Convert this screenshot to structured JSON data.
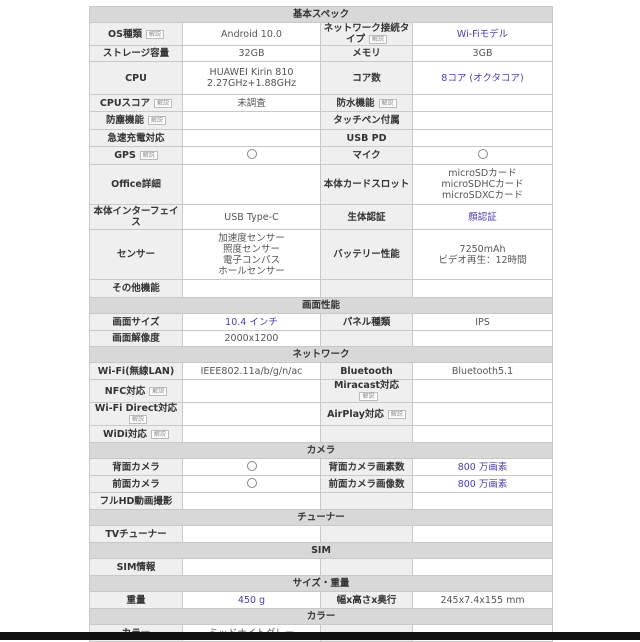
{
  "badge_text": "解説",
  "colors": {
    "link": "#4b3fae",
    "label_bg": "#efefef",
    "section_bg": "#d8d8d8"
  },
  "sections": [
    {
      "title": "基本スペック",
      "rows": [
        {
          "h": 22,
          "l1": "OS種類",
          "b1": true,
          "v1": "Android 10.0",
          "l2": "ネットワーク接続タイプ",
          "b2": true,
          "v2": "Wi-Fiモデル",
          "link2": true
        },
        {
          "h": 16,
          "l1": "ストレージ容量",
          "v1": "32GB",
          "l2": "メモリ",
          "v2": "3GB"
        },
        {
          "h": 33,
          "l1": "CPU",
          "v1": "HUAWEI Kirin 810\n2.27GHz+1.88GHz",
          "l2": "コア数",
          "v2": "8コア (オクタコア)",
          "link2": true
        },
        {
          "h": 17,
          "l1": "CPUスコア",
          "b1": true,
          "v1": "未調査",
          "l2": "防水機能",
          "b2": true,
          "v2": ""
        },
        {
          "h": 18,
          "l1": "防塵機能",
          "b1": true,
          "v1": "",
          "l2": "タッチペン付属",
          "v2": ""
        },
        {
          "h": 17,
          "l1": "急速充電対応",
          "v1": "",
          "l2": "USB PD",
          "v2": ""
        },
        {
          "h": 18,
          "l1": "GPS",
          "b1": true,
          "v1": "○",
          "c1": true,
          "l2": "マイク",
          "v2": "○",
          "c2": true
        },
        {
          "h": 40,
          "l1": "Office詳細",
          "v1": "",
          "l2": "本体カードスロット",
          "v2": "microSDカード\nmicroSDHCカード\nmicroSDXCカード"
        },
        {
          "h": 25,
          "l1": "本体インターフェイス",
          "v1": "USB Type-C",
          "l2": "生体認証",
          "v2": "顔認証",
          "link2": true
        },
        {
          "h": 50,
          "l1": "センサー",
          "v1": "加速度センサー\n照度センサー\n電子コンパス\nホールセンサー",
          "l2": "バッテリー性能",
          "v2": "7250mAh\nビデオ再生：12時間"
        },
        {
          "h": 18,
          "l1": "その他機能",
          "v1": "",
          "l2": "",
          "v2": ""
        }
      ]
    },
    {
      "title": "画面性能",
      "rows": [
        {
          "h": 17,
          "l1": "画面サイズ",
          "v1": "10.4 インチ",
          "link1": true,
          "l2": "パネル種類",
          "v2": "IPS"
        },
        {
          "h": 16,
          "l1": "画面解像度",
          "v1": "2000x1200",
          "l2": "",
          "v2": ""
        }
      ]
    },
    {
      "title": "ネットワーク",
      "rows": [
        {
          "h": 17,
          "l1": "Wi-Fi(無線LAN)",
          "v1": "IEEE802.11a/b/g/n/ac",
          "l2": "Bluetooth",
          "v2": "Bluetooth5.1"
        },
        {
          "h": 17,
          "l1": "NFC対応",
          "b1": true,
          "v1": "",
          "l2": "Miracast対応",
          "b2": true,
          "v2": ""
        },
        {
          "h": 23,
          "l1": "Wi-Fi Direct対応",
          "b1": true,
          "v1": "",
          "l2": "AirPlay対応",
          "b2": true,
          "v2": ""
        },
        {
          "h": 17,
          "l1": "WiDi対応",
          "b1": true,
          "v1": "",
          "l2": "",
          "v2": ""
        }
      ]
    },
    {
      "title": "カメラ",
      "rows": [
        {
          "h": 17,
          "l1": "背面カメラ",
          "v1": "○",
          "c1": true,
          "l2": "背面カメラ画素数",
          "v2": "800 万画素",
          "link2": true
        },
        {
          "h": 17,
          "l1": "前面カメラ",
          "v1": "○",
          "c1": true,
          "l2": "前面カメラ画像数",
          "v2": "800 万画素",
          "link2": true
        },
        {
          "h": 17,
          "l1": "フルHD動画撮影",
          "v1": "",
          "l2": "",
          "v2": ""
        }
      ]
    },
    {
      "title": "チューナー",
      "rows": [
        {
          "h": 17,
          "l1": "TVチューナー",
          "v1": "",
          "l2": "",
          "v2": ""
        }
      ]
    },
    {
      "title": "SIM",
      "rows": [
        {
          "h": 17,
          "l1": "SIM情報",
          "v1": "",
          "l2": "",
          "v2": ""
        }
      ]
    },
    {
      "title": "サイズ・重量",
      "rows": [
        {
          "h": 17,
          "l1": "重量",
          "v1": "450 g",
          "link1": true,
          "l2": "幅x高さx奥行",
          "v2": "245x7.4x155 mm"
        }
      ]
    },
    {
      "title": "カラー",
      "rows": [
        {
          "h": 17,
          "l1": "カラー",
          "v1": "ミッドナイトグレー",
          "l2": "",
          "v2": ""
        }
      ]
    }
  ]
}
